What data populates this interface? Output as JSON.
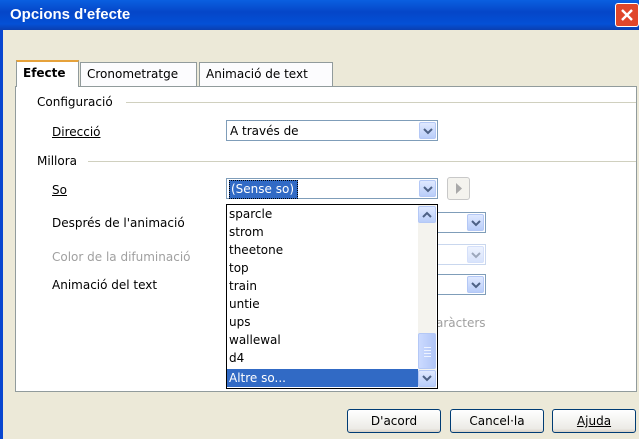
{
  "window": {
    "title": "Opcions d'efecte"
  },
  "tabs": [
    "Efecte",
    "Cronometratge",
    "Animació de text"
  ],
  "groups": {
    "configuracio": "Configuració",
    "millora": "Millora"
  },
  "fields": {
    "direccio": {
      "label": "Direcció",
      "value": "A través de"
    },
    "so": {
      "label": "So",
      "value": "(Sense so)"
    },
    "despres": {
      "label": "Després de l'animació"
    },
    "color": {
      "label": "Color de la difuminació"
    },
    "animacio_text": {
      "label": "Animació del text"
    }
  },
  "partial_hidden_text": "aràcters",
  "sound_list": [
    "sparcle",
    "strom",
    "theetone",
    "top",
    "train",
    "untie",
    "ups",
    "wallewal",
    "d4",
    "Altre so..."
  ],
  "sound_list_selected": "Altre so...",
  "buttons": {
    "ok": "D'acord",
    "cancel": "Cancel·la",
    "help": "Ajuda"
  },
  "colors": {
    "titlebar": "#0546c8",
    "selection": "#316ac5",
    "dialog_bg": "#ece9d8"
  },
  "icons": {
    "close": "close-icon",
    "dropdown": "chevron-down-icon",
    "play": "play-icon"
  }
}
